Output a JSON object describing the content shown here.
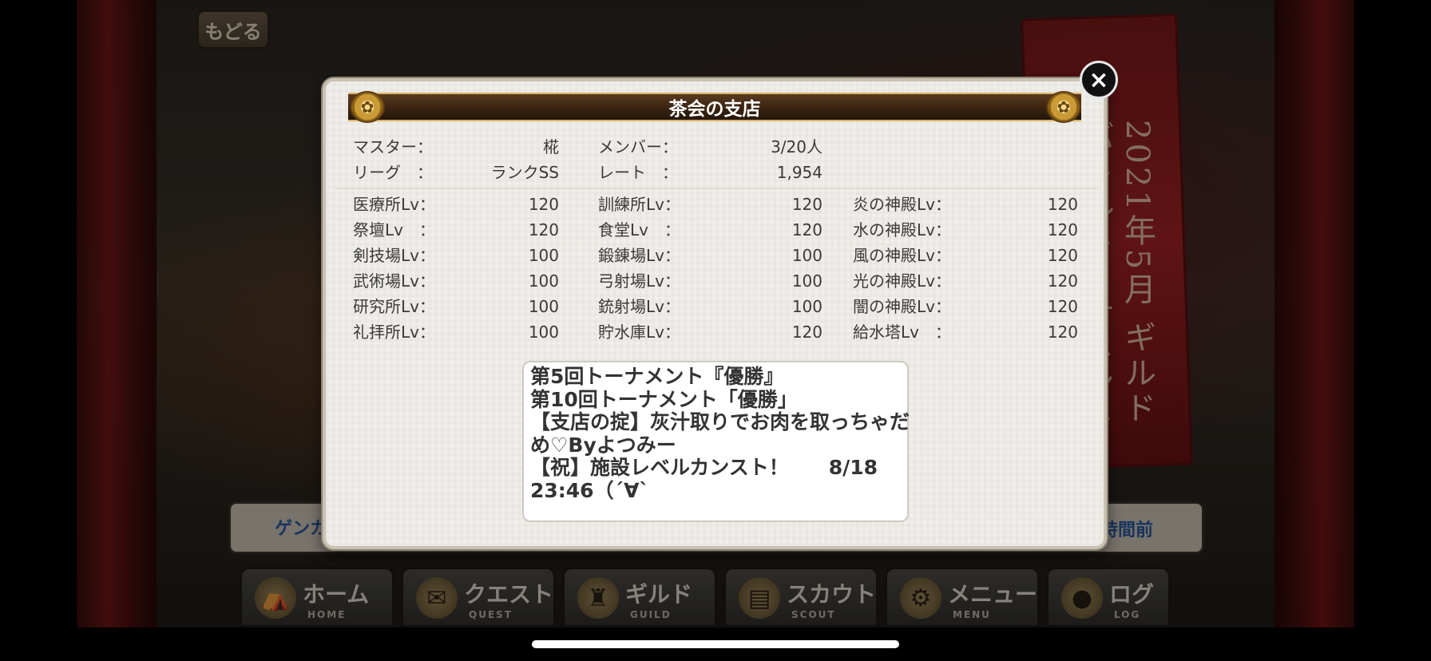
{
  "background": {
    "back_button": "もどる",
    "banner_text": "2021年5月 ギルドバトルトーナメント 総合優勝",
    "info_left": "ゲンカ",
    "info_right": "時間前",
    "nav": [
      {
        "label": "ホーム",
        "sub": "HOME",
        "icon": "tent-icon"
      },
      {
        "label": "クエスト",
        "sub": "QUEST",
        "icon": "map-icon"
      },
      {
        "label": "ギルド",
        "sub": "GUILD",
        "icon": "castle-icon"
      },
      {
        "label": "スカウト",
        "sub": "SCOUT",
        "icon": "book-icon"
      },
      {
        "label": "メニュー",
        "sub": "MENU",
        "icon": "gear-icon"
      },
      {
        "label": "ログ",
        "sub": "LOG",
        "icon": "chat-icon"
      }
    ]
  },
  "modal": {
    "title": "茶会の支店",
    "close_icon": "×",
    "summary": {
      "master_label": "マスター：",
      "master_value": "椛",
      "league_label": "リーグ　：",
      "league_value": "ランクSS",
      "member_label": "メンバー：",
      "member_value": "3/20人",
      "rate_label": "レート　：",
      "rate_value": "1,954"
    },
    "facilities_col1": [
      {
        "label": "医療所Lv：",
        "value": "120"
      },
      {
        "label": "祭壇Lv　：",
        "value": "120"
      },
      {
        "label": "剣技場Lv：",
        "value": "100"
      },
      {
        "label": "武術場Lv：",
        "value": "100"
      },
      {
        "label": "研究所Lv：",
        "value": "100"
      },
      {
        "label": "礼拝所Lv：",
        "value": "100"
      }
    ],
    "facilities_col2": [
      {
        "label": "訓練所Lv：",
        "value": "120"
      },
      {
        "label": "食堂Lv　：",
        "value": "120"
      },
      {
        "label": "鍛錬場Lv：",
        "value": "100"
      },
      {
        "label": "弓射場Lv：",
        "value": "100"
      },
      {
        "label": "銃射場Lv：",
        "value": "100"
      },
      {
        "label": "貯水庫Lv：",
        "value": "120"
      }
    ],
    "facilities_col3": [
      {
        "label": "炎の神殿Lv：",
        "value": "120"
      },
      {
        "label": "水の神殿Lv：",
        "value": "120"
      },
      {
        "label": "風の神殿Lv：",
        "value": "120"
      },
      {
        "label": "光の神殿Lv：",
        "value": "120"
      },
      {
        "label": "闇の神殿Lv：",
        "value": "120"
      },
      {
        "label": "給水塔Lv　：",
        "value": "120"
      }
    ],
    "message_lines": [
      "第5回トーナメント『優勝』",
      "第10回トーナメント「優勝」",
      "【支店の掟】灰汁取りでお肉を取っちゃだ",
      "め♡Byよつみー",
      "【祝】施設レベルカンスト！　　8/18",
      "23:46（´∀`"
    ]
  }
}
